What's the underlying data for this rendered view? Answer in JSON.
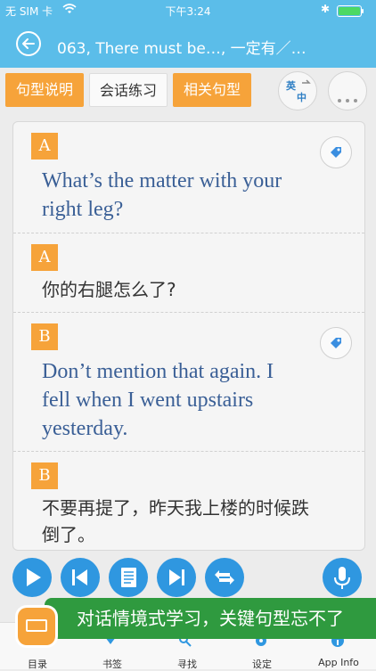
{
  "status": {
    "carrier": "无 SIM 卡",
    "time": "下午3:24",
    "bluetooth": "✱"
  },
  "nav": {
    "title": "063, There must be…, 一定有／…"
  },
  "tabs": [
    {
      "label": "句型说明",
      "style": "orange"
    },
    {
      "label": "会话练习",
      "style": "white"
    },
    {
      "label": "相关句型",
      "style": "orange"
    }
  ],
  "lang_toggle": {
    "top": "英",
    "bottom": "中"
  },
  "dialogue": [
    {
      "speaker": "A",
      "line1": "What’s the matter with your",
      "line2": "right leg?"
    },
    {
      "speaker": "A",
      "line1": "你的右腿怎么了?"
    },
    {
      "speaker": "B",
      "line1": "Don’t mention that again. I",
      "line2": "fell when I went upstairs",
      "line3": "yesterday."
    },
    {
      "speaker": "B",
      "line1": "不要再提了，昨天我上楼的时候跌",
      "line2": "倒了。"
    }
  ],
  "banner": {
    "text": "对话情境式学习，关键句型忘不了"
  },
  "tabbar": [
    {
      "label": "目录"
    },
    {
      "label": "书签"
    },
    {
      "label": "寻找"
    },
    {
      "label": "设定"
    },
    {
      "label": "App Info"
    }
  ],
  "colors": {
    "header": "#5bbde9",
    "accent": "#f6a33a",
    "player": "#2f97e0",
    "english": "#3a5f96",
    "banner": "#2f9a3f"
  }
}
